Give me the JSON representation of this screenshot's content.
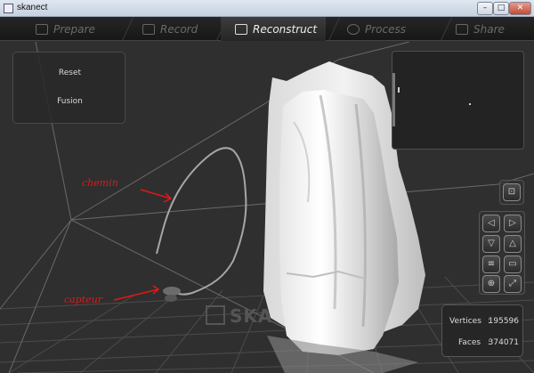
{
  "window": {
    "title": "skanect",
    "min_glyph": "–",
    "max_glyph": "□",
    "close_glyph": "✕"
  },
  "tabs": [
    {
      "label": "Prepare",
      "icon": "prepare-icon",
      "active": false
    },
    {
      "label": "Record",
      "icon": "film-icon",
      "active": false
    },
    {
      "label": "Reconstruct",
      "icon": "film-icon",
      "active": true
    },
    {
      "label": "Process",
      "icon": "gears-icon",
      "active": false
    },
    {
      "label": "Share",
      "icon": "thumbs-up-icon",
      "active": false
    }
  ],
  "left_panel": {
    "reset_label": "Reset",
    "fusion_label": "Fusion"
  },
  "tools": {
    "a": {
      "icon": "capture-icon",
      "glyph": "⊡"
    },
    "b": [
      {
        "icon": "arrow-left-icon",
        "glyph": "◁"
      },
      {
        "icon": "arrow-right-icon",
        "glyph": "▷"
      },
      {
        "icon": "view-front-icon",
        "glyph": "▽"
      },
      {
        "icon": "view-back-icon",
        "glyph": "△"
      },
      {
        "icon": "view-side-icon",
        "glyph": "≡"
      },
      {
        "icon": "view-top-icon",
        "glyph": "▭"
      },
      {
        "icon": "zoom-icon",
        "glyph": "⊕"
      },
      {
        "icon": "fit-view-icon",
        "glyph": "⤢"
      }
    ]
  },
  "stats": {
    "vertices_label": "Vertices",
    "vertices_value": "195596",
    "faces_label": "Faces",
    "faces_value": "374071",
    "separator": ":"
  },
  "annotations": {
    "path_label": "chemin",
    "sensor_label": "capteur"
  },
  "watermark": "SKA",
  "colors": {
    "annotation_red": "#e01818",
    "active_tab_text": "#eeeeee",
    "inactive_tab_text": "#6a6a6a"
  }
}
